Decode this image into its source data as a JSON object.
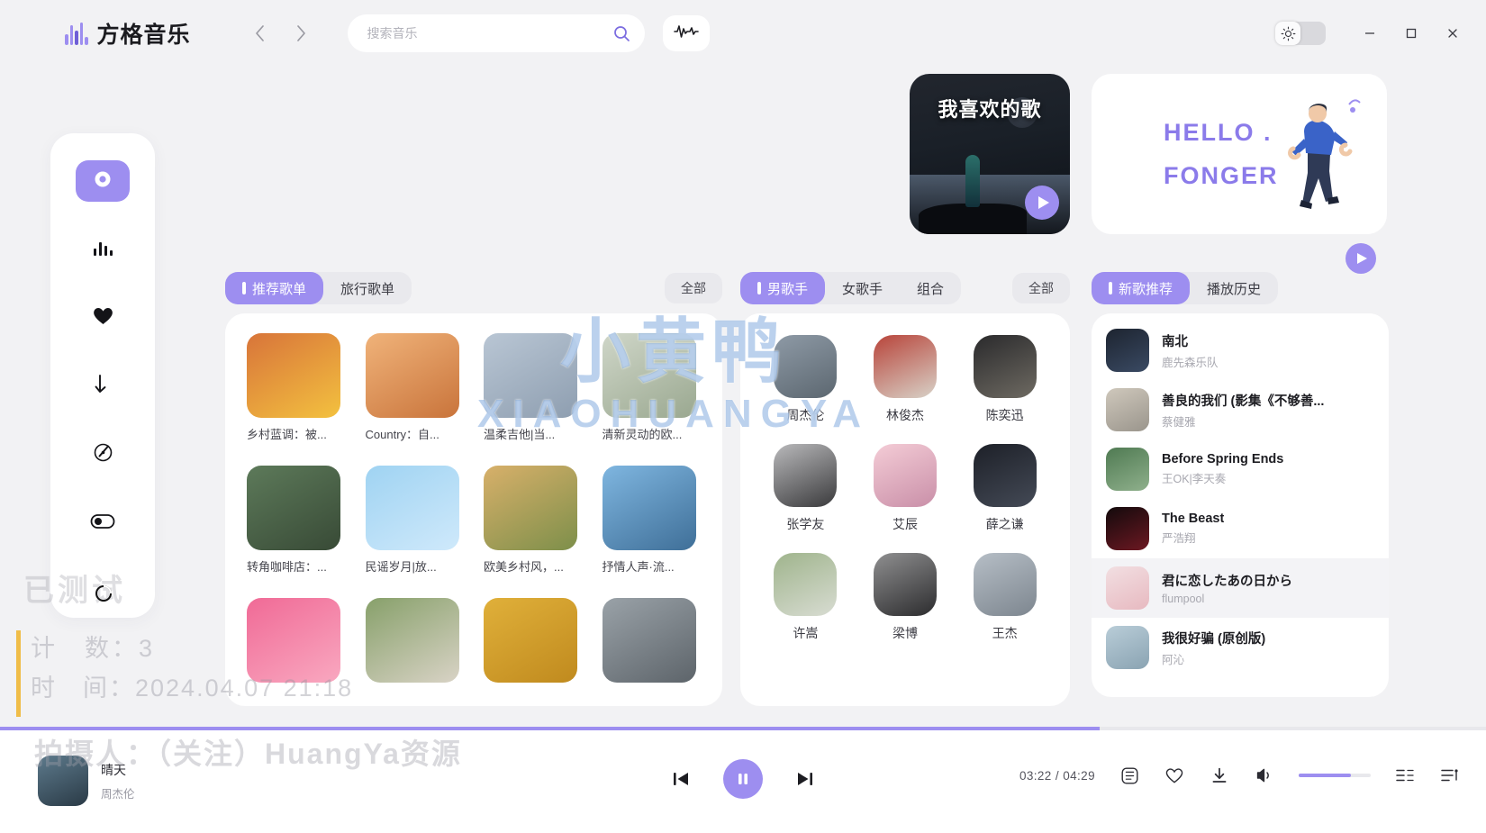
{
  "app": {
    "brand": "方格音乐",
    "brand_icon": "equalizer-bars-logo"
  },
  "topbar": {
    "back_icon": "chevron-left-icon",
    "forward_icon": "chevron-right-icon",
    "search_placeholder": "搜索音乐",
    "search_value": "",
    "search_icon": "search-icon",
    "wave_icon": "waveform-icon",
    "theme_icon": "sun-icon",
    "minimize_icon": "minimize-icon",
    "maximize_icon": "maximize-icon",
    "close_icon": "close-icon"
  },
  "sidebar": {
    "items": [
      {
        "name": "discover",
        "icon": "disc-icon",
        "active": true
      },
      {
        "name": "charts",
        "icon": "bar-chart-icon",
        "active": false
      },
      {
        "name": "favorites",
        "icon": "heart-icon",
        "active": false
      },
      {
        "name": "downloads",
        "icon": "download-arrow-icon",
        "active": false
      },
      {
        "name": "radar",
        "icon": "compass-icon",
        "active": false
      },
      {
        "name": "settings-toggle",
        "icon": "toggle-icon",
        "active": false
      }
    ]
  },
  "banners": {
    "like": {
      "title": "我喜欢的歌",
      "play_icon": "play-icon"
    },
    "hello": {
      "line1": "HELLO .",
      "line2": "FONGER",
      "accent": "#8b7bea"
    }
  },
  "playlist_section": {
    "tabs": [
      {
        "label": "推荐歌单",
        "active": true
      },
      {
        "label": "旅行歌单",
        "active": false
      }
    ],
    "all_label": "全部",
    "cards": [
      {
        "name": "乡村蓝调：被...",
        "c1": "#d8743a",
        "c2": "#f3c13f"
      },
      {
        "name": "Country：自...",
        "c1": "#f0b37a",
        "c2": "#c9743b"
      },
      {
        "name": "温柔吉他|当...",
        "c1": "#b9c6d4",
        "c2": "#8e9eb0"
      },
      {
        "name": "清新灵动的欧...",
        "c1": "#cfd6c8",
        "c2": "#9aa890"
      },
      {
        "name": "转角咖啡店：...",
        "c1": "#5d7a5a",
        "c2": "#384a36"
      },
      {
        "name": "民谣岁月|放...",
        "c1": "#9fd3f2",
        "c2": "#cfe9fb"
      },
      {
        "name": "欧美乡村风，...",
        "c1": "#d8b06a",
        "c2": "#7d8f4a"
      },
      {
        "name": "抒情人声·流...",
        "c1": "#7fb6e0",
        "c2": "#3f6f98"
      },
      {
        "name": "",
        "c1": "#f06a96",
        "c2": "#f9a8c0"
      },
      {
        "name": "",
        "c1": "#87a06a",
        "c2": "#d9d3c6"
      },
      {
        "name": "",
        "c1": "#e0b03a",
        "c2": "#c08a1e"
      },
      {
        "name": "",
        "c1": "#9aa2a8",
        "c2": "#5d646a"
      }
    ]
  },
  "artist_section": {
    "tabs": [
      {
        "label": "男歌手",
        "active": true
      },
      {
        "label": "女歌手",
        "active": false
      },
      {
        "label": "组合",
        "active": false
      }
    ],
    "all_label": "全部",
    "artists": [
      {
        "name": "周杰伦",
        "c1": "#8e9aa6",
        "c2": "#5c6770"
      },
      {
        "name": "林俊杰",
        "c1": "#b8443a",
        "c2": "#d8d2c8"
      },
      {
        "name": "陈奕迅",
        "c1": "#2a2a2c",
        "c2": "#6e6a62"
      },
      {
        "name": "张学友",
        "c1": "#b9b9bb",
        "c2": "#3a3a3c"
      },
      {
        "name": "艾辰",
        "c1": "#f4ccd6",
        "c2": "#c98fa8"
      },
      {
        "name": "薛之谦",
        "c1": "#1d2028",
        "c2": "#444a56"
      },
      {
        "name": "许嵩",
        "c1": "#9fb48c",
        "c2": "#d8dcd2"
      },
      {
        "name": "梁博",
        "c1": "#8f8f90",
        "c2": "#2c2c2e"
      },
      {
        "name": "王杰",
        "c1": "#b6bec6",
        "c2": "#7d868f"
      }
    ]
  },
  "song_section": {
    "tabs": [
      {
        "label": "新歌推荐",
        "active": true
      },
      {
        "label": "播放历史",
        "active": false
      }
    ],
    "play_icon": "play-icon",
    "songs": [
      {
        "title": "南北",
        "artist": "鹿先森乐队",
        "c1": "#1d2430",
        "c2": "#3a4a63",
        "highlight": false
      },
      {
        "title": "善良的我们 (影集《不够善...",
        "artist": "蔡健雅",
        "c1": "#cfc8bc",
        "c2": "#9a958c",
        "highlight": false
      },
      {
        "title": "Before Spring Ends",
        "artist": "王OK|李天奏",
        "c1": "#4f7a52",
        "c2": "#8fb08c",
        "highlight": false
      },
      {
        "title": "The Beast",
        "artist": "严浩翔",
        "c1": "#120a0c",
        "c2": "#6d1822",
        "highlight": false
      },
      {
        "title": "君に恋したあの日から",
        "artist": "flumpool",
        "c1": "#f2dfe2",
        "c2": "#e7b9c0",
        "highlight": true
      },
      {
        "title": "我很好骗 (原创版)",
        "artist": "阿沁",
        "c1": "#b9cdd8",
        "c2": "#8aa3b2",
        "highlight": false
      }
    ]
  },
  "player": {
    "now_playing": {
      "title": "晴天",
      "artist": "周杰伦",
      "c1": "#5d7a8c",
      "c2": "#2a3a46"
    },
    "prev_icon": "skip-previous-icon",
    "play_icon": "pause-icon",
    "next_icon": "skip-next-icon",
    "current_time": "03:22",
    "separator": "/",
    "total_time": "04:29",
    "progress_percent": 74,
    "volume_percent": 72,
    "lyrics_icon": "lyrics-icon",
    "favorite_icon": "heart-outline-icon",
    "download_icon": "download-icon",
    "volume_icon": "volume-icon",
    "list_icon": "playlist-icon",
    "queue_icon": "queue-icon",
    "accent": "#9d8ef0"
  },
  "watermarks": {
    "center_line1": "小黄鸭",
    "center_line2": "XIAOHUANGYA",
    "tested": "已测试",
    "count_label": "计　数：3",
    "time_label": "时　间：2024.04.07 21:18",
    "bottom": "拍摄人：（关注）HuangYa资源"
  }
}
